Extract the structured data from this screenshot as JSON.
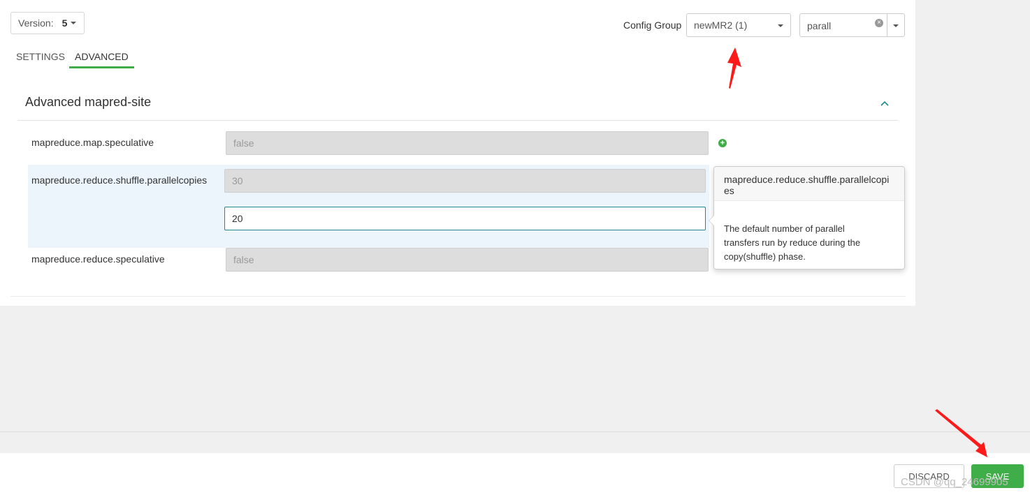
{
  "version": {
    "label": "Version:",
    "number": "5"
  },
  "tabs": [
    {
      "label": "SETTINGS",
      "active": false
    },
    {
      "label": "ADVANCED",
      "active": true
    }
  ],
  "config_group": {
    "label": "Config Group",
    "selected": "newMR2 (1)"
  },
  "filter": {
    "value": "parall",
    "clear_icon": "clear-icon"
  },
  "section": {
    "title": "Advanced mapred-site"
  },
  "properties": [
    {
      "name": "mapreduce.map.speculative",
      "value": "false"
    },
    {
      "name": "mapreduce.reduce.shuffle.parallelcopies",
      "value": "30",
      "override_value": "20"
    },
    {
      "name": "mapreduce.reduce.speculative",
      "value": "false"
    }
  ],
  "popover": {
    "title": "mapreduce.reduce.shuffle.parallelcopies",
    "body": "The default number of parallel transfers run by reduce during the copy(shuffle) phase."
  },
  "footer": {
    "discard_label": "DISCARD",
    "save_label": "SAVE"
  },
  "watermark": "CSDN @qq_24699905",
  "colors": {
    "accent": "#3fae49",
    "focus_border": "#1d8a8f",
    "annotation_arrow": "#ff1a1a"
  }
}
